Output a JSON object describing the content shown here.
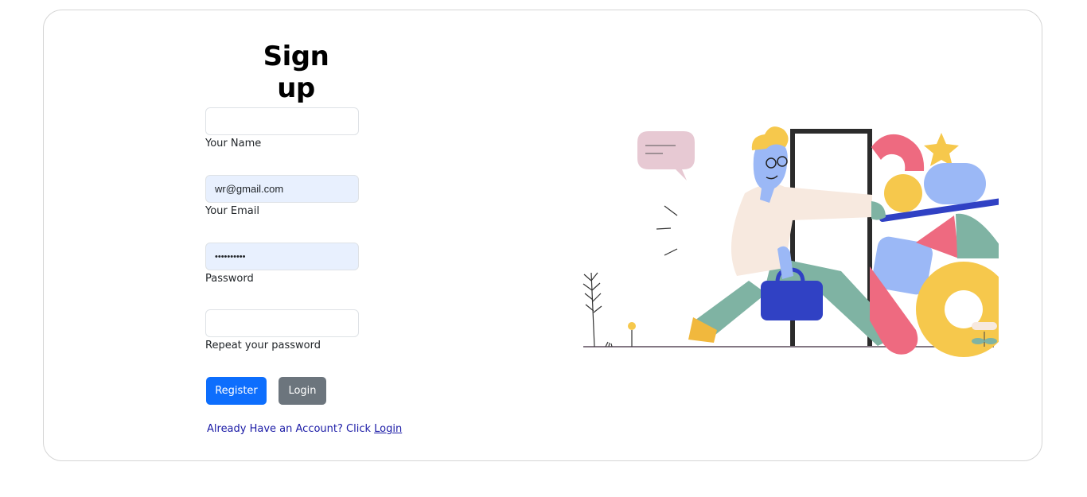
{
  "form": {
    "title": "Sign up",
    "name": {
      "label": "Your Name",
      "value": "",
      "placeholder": ""
    },
    "email": {
      "label": "Your Email",
      "value": "wr@gmail.com",
      "placeholder": ""
    },
    "password": {
      "label": "Password",
      "value": "••••••••••",
      "placeholder": ""
    },
    "repeat_password": {
      "label": "Repeat your password",
      "value": "",
      "placeholder": ""
    },
    "register_label": "Register",
    "login_label": "Login",
    "footer_text": "Already Have an Account? Click ",
    "footer_link": "Login"
  },
  "colors": {
    "primary": "#0d6efd",
    "secondary": "#6c757d",
    "autofill": "#e8f0fe",
    "link": "#1a1aa6"
  },
  "illustration": {
    "icon": "signup-illustration-person-door-icon"
  }
}
